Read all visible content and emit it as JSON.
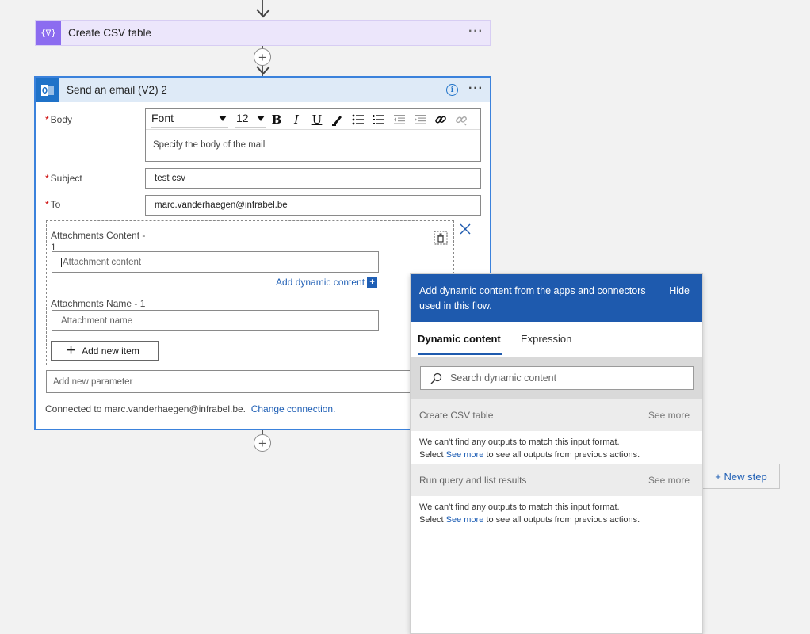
{
  "create_csv": {
    "title": "Create CSV table",
    "icon_text": "{∇}"
  },
  "email_card": {
    "title": "Send an email (V2) 2",
    "body": {
      "label": "Body",
      "font_value": "Font",
      "size_value": "12",
      "placeholder": "Specify the body of the mail",
      "toolbar": {
        "bold": "B",
        "italic": "I",
        "underline": "U"
      }
    },
    "subject": {
      "label": "Subject",
      "value": "test csv"
    },
    "to": {
      "label": "To",
      "value": "marc.vanderhaegen@infrabel.be"
    },
    "attachments": {
      "content_label_line1": "Attachments Content -",
      "content_label_line2": "1",
      "content_placeholder": "Attachment content",
      "add_dynamic": "Add dynamic content",
      "name_label": "Attachments Name - 1",
      "name_placeholder": "Attachment name",
      "add_item": "Add new item"
    },
    "add_param_placeholder": "Add new parameter",
    "connected_text": "Connected to marc.vanderhaegen@infrabel.be.",
    "change_connection": "Change connection."
  },
  "dynamic_panel": {
    "message": "Add dynamic content from the apps and connectors used in this flow.",
    "hide": "Hide",
    "tabs": [
      "Dynamic content",
      "Expression"
    ],
    "search_placeholder": "Search dynamic content",
    "sections": [
      {
        "name": "Create CSV table",
        "see_more": "See more",
        "line1": "We can't find any outputs to match this input format.",
        "line2_pre": "Select ",
        "line2_link": "See more",
        "line2_post": " to see all outputs from previous actions."
      },
      {
        "name": "Run query and list results",
        "see_more": "See more",
        "line1": "We can't find any outputs to match this input format.",
        "line2_pre": "Select ",
        "line2_link": "See more",
        "line2_post": " to see all outputs from previous actions."
      }
    ]
  },
  "new_step": "+ New step",
  "colors": {
    "accent": "#1e5aae",
    "csv_icon": "#8c6cf0",
    "outlook_icon": "#1f72c8"
  }
}
